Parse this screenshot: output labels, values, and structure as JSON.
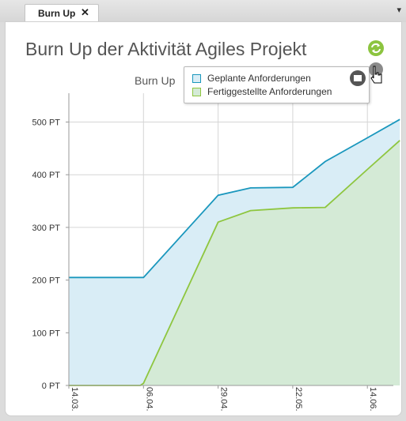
{
  "tab": {
    "label": "Burn Up",
    "close_glyph": "✕",
    "menu_glyph": "▾"
  },
  "header": {
    "title": "Burn Up der Aktivität  Agiles Projekt"
  },
  "chart_data": {
    "type": "area",
    "title": "Burn Up",
    "x_ticks": [
      "14.03.",
      "06.04.",
      "29.04.",
      "22.05.",
      "14.06."
    ],
    "y_ticks": [
      "0 PT",
      "100 PT",
      "200 PT",
      "300 PT",
      "400 PT",
      "500 PT"
    ],
    "ylim": [
      0,
      500
    ],
    "grid": true,
    "legend_position": "top-right",
    "series": [
      {
        "name": "Geplante Anforderungen",
        "color": "#1a97bd",
        "fill": "#d9edf6",
        "x": [
          "14.03.",
          "06.04.",
          "29.04.",
          "09.05.",
          "22.05.",
          "01.06.",
          "14.06.",
          "24.06."
        ],
        "values": [
          205,
          205,
          361,
          375,
          376,
          425,
          470,
          505
        ]
      },
      {
        "name": "Fertiggestellte Anforderungen",
        "color": "#8ec63f",
        "fill": "#d4ead6",
        "x": [
          "14.03.",
          "05.04.",
          "06.04.",
          "29.04.",
          "09.05.",
          "22.05.",
          "01.06.",
          "14.06.",
          "24.06."
        ],
        "values": [
          0,
          0,
          4,
          310,
          332,
          337,
          338,
          410,
          465
        ]
      }
    ]
  }
}
